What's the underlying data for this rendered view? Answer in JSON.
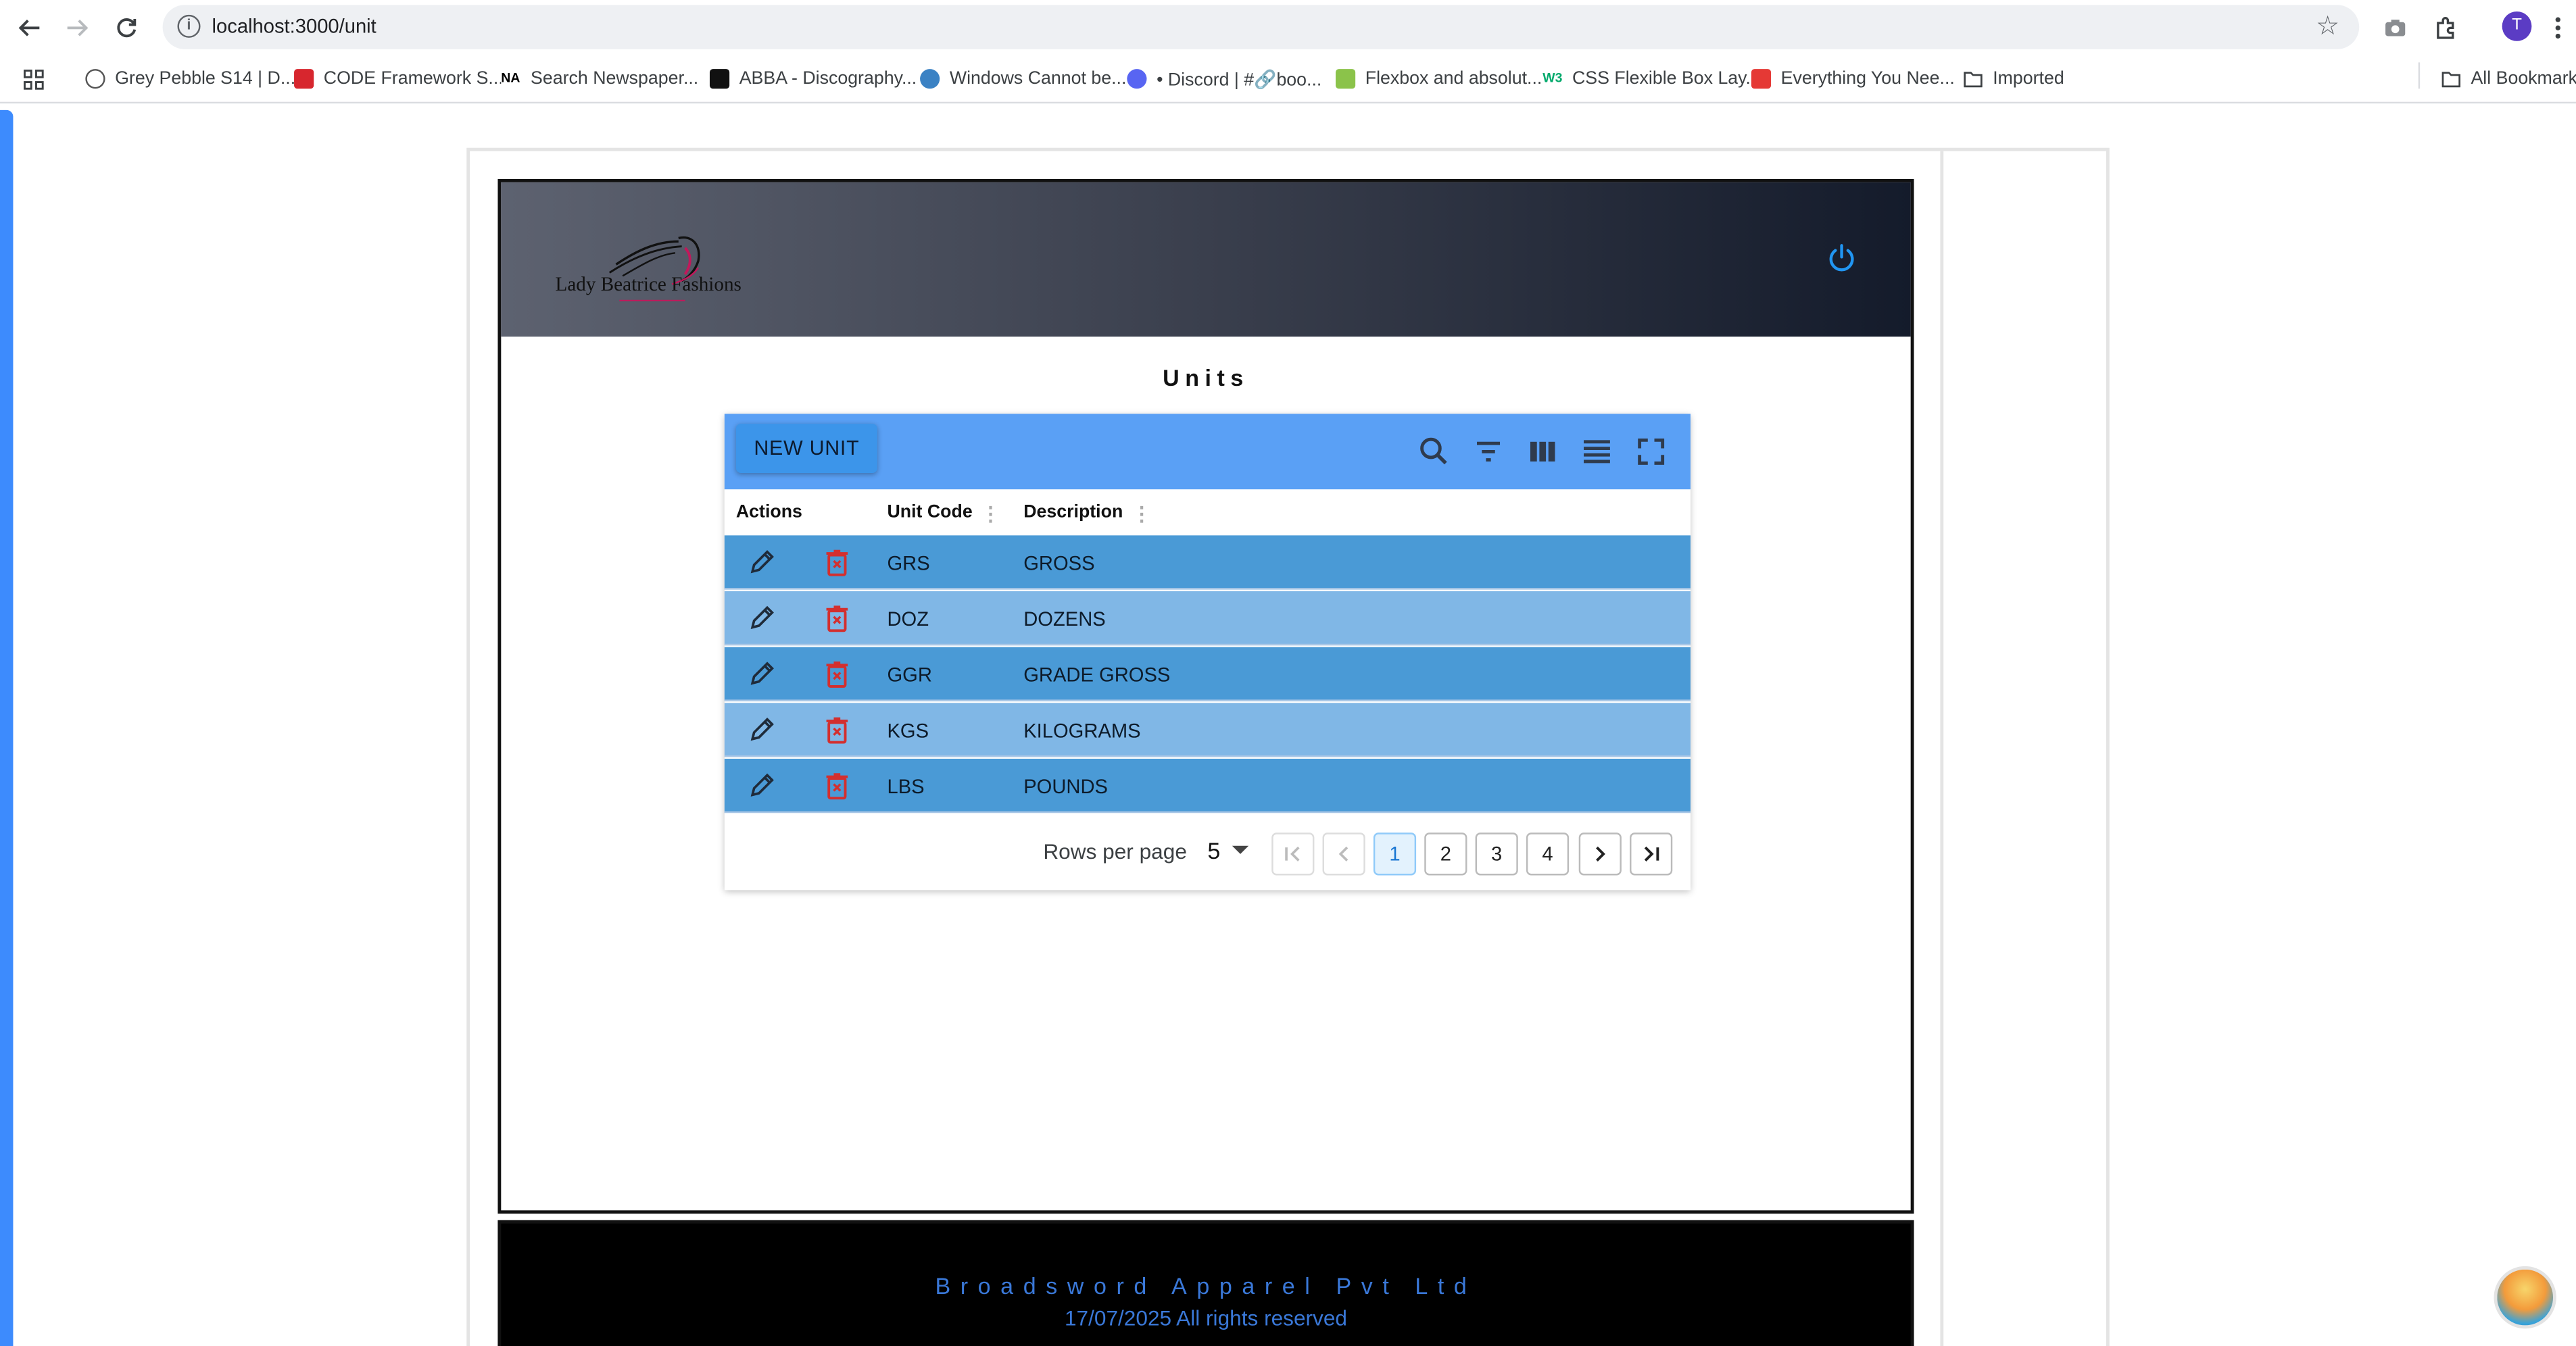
{
  "browser": {
    "url": "localhost:3000/unit",
    "avatar_letter": "T",
    "bookmarks": [
      "Grey Pebble S14 | D...",
      "CODE Framework S...",
      "Search Newspaper...",
      "ABBA - Discography...",
      "Windows Cannot be...",
      "• Discord | #🔗boo...",
      "Flexbox and absolut...",
      "CSS Flexible Box Lay...",
      "Everything You Nee...",
      "Imported"
    ],
    "all_bookmarks": "All Bookmarks"
  },
  "app": {
    "brand": "Lady Beatrice Fashions",
    "page_title": "Units",
    "new_button": "NEW UNIT",
    "columns": [
      "Actions",
      "Unit Code",
      "Description"
    ],
    "rows": [
      {
        "code": "GRS",
        "description": "GROSS"
      },
      {
        "code": "DOZ",
        "description": "DOZENS"
      },
      {
        "code": "GGR",
        "description": "GRADE GROSS"
      },
      {
        "code": "KGS",
        "description": "KILOGRAMS"
      },
      {
        "code": "LBS",
        "description": "POUNDS"
      }
    ],
    "pagination": {
      "rows_per_page_label": "Rows per page",
      "rows_per_page": "5",
      "pages": [
        "1",
        "2",
        "3",
        "4"
      ],
      "current_page": "1"
    },
    "footer": {
      "company": "Broadsword Apparel Pvt Ltd",
      "rights": "17/07/2025 All rights reserved"
    }
  },
  "colors": {
    "header_gradient_start": "#5d6270",
    "header_gradient_end": "#141b2b",
    "toolbar_blue": "#5aa0f5",
    "row_dark": "#4a9ad6",
    "row_light": "#80b7e6",
    "delete_red": "#d32f2f",
    "footer_text": "#3a78d8"
  }
}
